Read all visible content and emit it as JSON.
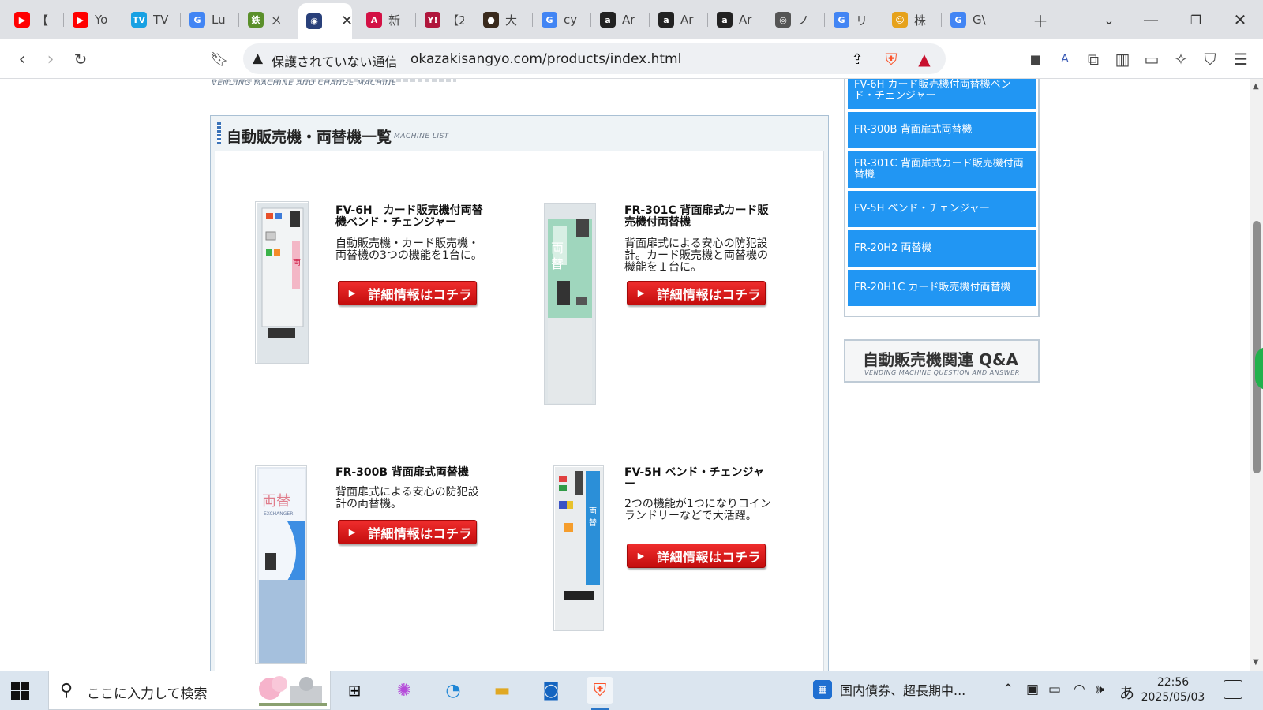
{
  "tabs": [
    {
      "title": "【",
      "icon": "youtube-icon",
      "color": "#ff0000",
      "glyph": "▶"
    },
    {
      "title": "Yo",
      "icon": "youtube-icon",
      "color": "#ff0000",
      "glyph": "▶"
    },
    {
      "title": "TV",
      "icon": "tver-icon",
      "color": "#18a1e3",
      "glyph": "TV"
    },
    {
      "title": "Lu",
      "icon": "google-icon",
      "color": "#4285f4",
      "glyph": "G"
    },
    {
      "title": "メ",
      "icon": "site-icon",
      "color": "#5a8f2a",
      "glyph": "鉄"
    },
    {
      "title": "",
      "icon": "eye-icon",
      "color": "#29407a",
      "glyph": "◉",
      "active": true
    },
    {
      "title": "新",
      "icon": "news-icon",
      "color": "#d31145",
      "glyph": "A"
    },
    {
      "title": "【2",
      "icon": "yahoo-icon",
      "color": "#b0163c",
      "glyph": "Y!"
    },
    {
      "title": "大",
      "icon": "bear-icon",
      "color": "#3a2a1d",
      "glyph": "●"
    },
    {
      "title": "cy",
      "icon": "google-icon",
      "color": "#4285f4",
      "glyph": "G"
    },
    {
      "title": "Ar",
      "icon": "amazon-icon",
      "color": "#222222",
      "glyph": "a"
    },
    {
      "title": "Ar",
      "icon": "amazon-icon",
      "color": "#222222",
      "glyph": "a"
    },
    {
      "title": "Ar",
      "icon": "amazon-icon",
      "color": "#222222",
      "glyph": "a"
    },
    {
      "title": "ノ",
      "icon": "loading-icon",
      "color": "#555555",
      "glyph": "◎"
    },
    {
      "title": "リ",
      "icon": "google-icon",
      "color": "#4285f4",
      "glyph": "G"
    },
    {
      "title": "株",
      "icon": "site-icon",
      "color": "#e6a21c",
      "glyph": "☺"
    },
    {
      "title": "G\\",
      "icon": "google-icon",
      "color": "#4285f4",
      "glyph": "G"
    }
  ],
  "omnibox": {
    "security_label": "保護されていない通信",
    "url": "okazakisangyo.com/products/index.html"
  },
  "page": {
    "logo_en": "VENDING MACHINE AND CHANGE MACHINE",
    "list_title": "自動販売機・両替機一覧",
    "list_title_en": "MACHINE LIST",
    "detail_button_label": "詳細情報はコチラ",
    "products": [
      {
        "name": "FV-6H　カード販売機付両替機ベンド・チェンジャー",
        "desc": "自動販売機・カード販売機・両替機の3つの機能を1台に。"
      },
      {
        "name": "FR-301C 背面扉式カード販売機付両替機",
        "desc": "背面扉式による安心の防犯設計。カード販売機と両替機の機能を１台に。"
      },
      {
        "name": "FR-300B 背面扉式両替機",
        "desc": "背面扉式による安心の防犯設計の両替機。"
      },
      {
        "name": "FV-5H ベンド・チェンジャー",
        "desc": "2つの機能が1つになりコインランドリーなどで大活躍。"
      }
    ],
    "sidebar": [
      "FV-6H カード販売機付両替機ベンド・チェンジャー",
      "FR-300B 背面扉式両替機",
      "FR-301C 背面扉式カード販売機付両替機",
      "FV-5H ベンド・チェンジャー",
      "FR-20H2 両替機",
      "FR-20H1C カード販売機付両替機"
    ],
    "qa_title": "自動販売機関連 Q&A",
    "qa_en": "VENDING MACHINE QUESTION AND ANSWER"
  },
  "taskbar": {
    "search_placeholder": "ここに入力して検索",
    "news": "国内債券、超長期中...",
    "ime": "あ",
    "time": "22:56",
    "date": "2025/05/03"
  },
  "colors": {
    "sidebar_blue": "#2196f3",
    "button_red": "#d91a1a",
    "brave_orange": "#fb542b"
  }
}
